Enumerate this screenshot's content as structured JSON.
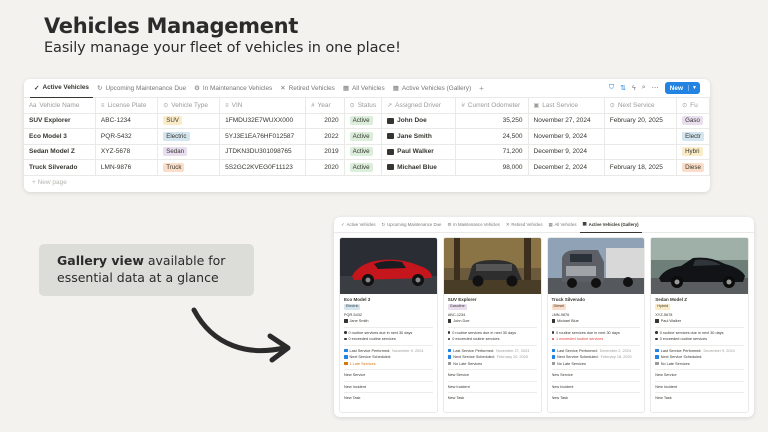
{
  "hero": {
    "title": "Vehicles Management",
    "subtitle": "Easily manage your fleet of vehicles in one place!"
  },
  "tabs": [
    {
      "label": "Active Vehicles",
      "icon": "check-icon",
      "active": true
    },
    {
      "label": "Upcoming Maintenance Due",
      "icon": "refresh-icon",
      "active": false
    },
    {
      "label": "In Maintenance Vehicles",
      "icon": "gear-icon",
      "active": false
    },
    {
      "label": "Retired Vehicles",
      "icon": "x-icon",
      "active": false
    },
    {
      "label": "All Vehicles",
      "icon": "table-icon",
      "active": false
    },
    {
      "label": "Active Vehicles (Gallery)",
      "icon": "gallery-icon",
      "active": false
    }
  ],
  "toolbar": {
    "new_label": "New",
    "tools": [
      "filter-icon",
      "sort-icon",
      "lightning-icon",
      "search-icon",
      "more-icon"
    ]
  },
  "table": {
    "columns": [
      {
        "label": "Vehicle Name",
        "icon": "Aa"
      },
      {
        "label": "License Plate",
        "icon": "≡"
      },
      {
        "label": "Vehicle Type",
        "icon": "⊙"
      },
      {
        "label": "VIN",
        "icon": "≡"
      },
      {
        "label": "Year",
        "icon": "#"
      },
      {
        "label": "Status",
        "icon": "⊙"
      },
      {
        "label": "Assigned Driver",
        "icon": "↗"
      },
      {
        "label": "Current Odometer",
        "icon": "#"
      },
      {
        "label": "Last Service",
        "icon": "▣"
      },
      {
        "label": "Next Service",
        "icon": "⊙"
      },
      {
        "label": "Fu",
        "icon": "⊙"
      }
    ],
    "rows": [
      {
        "name": "SUV Explorer",
        "plate": "ABC-1234",
        "type": "SUV",
        "vin": "1FMDU32E7WUXX000",
        "year": "2020",
        "status": "Active",
        "driver": "John Doe",
        "odometer": "35,250",
        "last_service": "November 27, 2024",
        "next_service": "February 20, 2025",
        "fuel": "Gaso"
      },
      {
        "name": "Eco Model 3",
        "plate": "PQR-5432",
        "type": "Electric",
        "vin": "5YJ3E1EA76HF012587",
        "year": "2022",
        "status": "Active",
        "driver": "Jane Smith",
        "odometer": "24,500",
        "last_service": "November 9, 2024",
        "next_service": "",
        "fuel": "Electr"
      },
      {
        "name": "Sedan Model Z",
        "plate": "XYZ-5678",
        "type": "Sedan",
        "vin": "JTDKN3DU301098765",
        "year": "2019",
        "status": "Active",
        "driver": "Paul Walker",
        "odometer": "71,200",
        "last_service": "December 9, 2024",
        "next_service": "",
        "fuel": "Hybri"
      },
      {
        "name": "Truck Silverado",
        "plate": "LMN-9876",
        "type": "Truck",
        "vin": "5S2GC2KVEG0F11123",
        "year": "2020",
        "status": "Active",
        "driver": "Michael Blue",
        "odometer": "98,000",
        "last_service": "December 2, 2024",
        "next_service": "February 18, 2025",
        "fuel": "Diese"
      }
    ],
    "new_page": "New page"
  },
  "tag_colors": {
    "SUV": "#fbecc8",
    "Electric": "#d3e5ef",
    "Sedan": "#e8deee",
    "Truck": "#fadec9",
    "Active": "#dbeddb",
    "Gaso": "#e8deee",
    "Electr": "#d3e5ef",
    "Hybri": "#fbecc8",
    "Diese": "#fadec9"
  },
  "callout": {
    "bold": "Gallery view",
    "rest": " available for essential data at a glance"
  },
  "gallery": {
    "tabs": [
      {
        "label": "Active Vehicles",
        "icon": "✓",
        "active": false
      },
      {
        "label": "Upcoming Maintenance Due",
        "icon": "↻",
        "active": false
      },
      {
        "label": "In Maintenance Vehicles",
        "icon": "⚙",
        "active": false
      },
      {
        "label": "Retired Vehicles",
        "icon": "✕",
        "active": false
      },
      {
        "label": "All Vehicles",
        "icon": "▦",
        "active": false
      },
      {
        "label": "Active Vehicles (Gallery)",
        "icon": "▦",
        "active": true
      }
    ],
    "cards": [
      {
        "name": "Eco Model 3",
        "tag": "Electric",
        "tag_color": "#d3e5ef",
        "plate": "PQR-5432",
        "driver": "Jane Smith",
        "routine_due": "0 routine services due in next 30 days",
        "exceeded": "0 exceeded routine services",
        "exceeded_alert": false,
        "last_label": "Last Service Performed:",
        "last_date": "November 9, 2024",
        "next_label": "Next Service Scheduled:",
        "next_date": "",
        "late": "1 Late Services",
        "late_alert": true,
        "links": [
          "New Service",
          "New Incident",
          "New Task"
        ],
        "img": "red-car"
      },
      {
        "name": "SUV Explorer",
        "tag": "Gasoline",
        "tag_color": "#e8deee",
        "plate": "ABC-1234",
        "driver": "John Doe",
        "routine_due": "0 routine services due in next 30 days",
        "exceeded": "0 exceeded routine services",
        "exceeded_alert": false,
        "last_label": "Last Service Performed:",
        "last_date": "November 27, 2024",
        "next_label": "Next Service Scheduled:",
        "next_date": "February 20, 2025",
        "late": "No Late Services",
        "late_alert": false,
        "links": [
          "New Service",
          "New Incident",
          "New Task"
        ],
        "img": "suv-forest"
      },
      {
        "name": "Truck Silverado",
        "tag": "Diesel",
        "tag_color": "#fadec9",
        "plate": "LMN-9876",
        "driver": "Michael Blue",
        "routine_due": "0 routine services due in next 30 days",
        "exceeded": "1 exceeded routine services",
        "exceeded_alert": true,
        "last_label": "Last Service Performed:",
        "last_date": "December 2, 2024",
        "next_label": "Next Service Scheduled:",
        "next_date": "February 18, 2025",
        "late": "No Late Services",
        "late_alert": false,
        "links": [
          "New Service",
          "New Incident",
          "New Task"
        ],
        "img": "truck-road"
      },
      {
        "name": "Sedan Model Z",
        "tag": "Hybrid",
        "tag_color": "#fbecc8",
        "plate": "XYZ-5678",
        "driver": "Paul Walker",
        "routine_due": "0 routine services due in next 30 days",
        "exceeded": "0 exceeded routine services",
        "exceeded_alert": false,
        "last_label": "Last Service Performed:",
        "last_date": "December 9, 2024",
        "next_label": "Next Service Scheduled:",
        "next_date": "",
        "late": "No Late Services",
        "late_alert": false,
        "links": [
          "New Service",
          "New Incident",
          "New Task"
        ],
        "img": "black-sedan"
      }
    ]
  }
}
